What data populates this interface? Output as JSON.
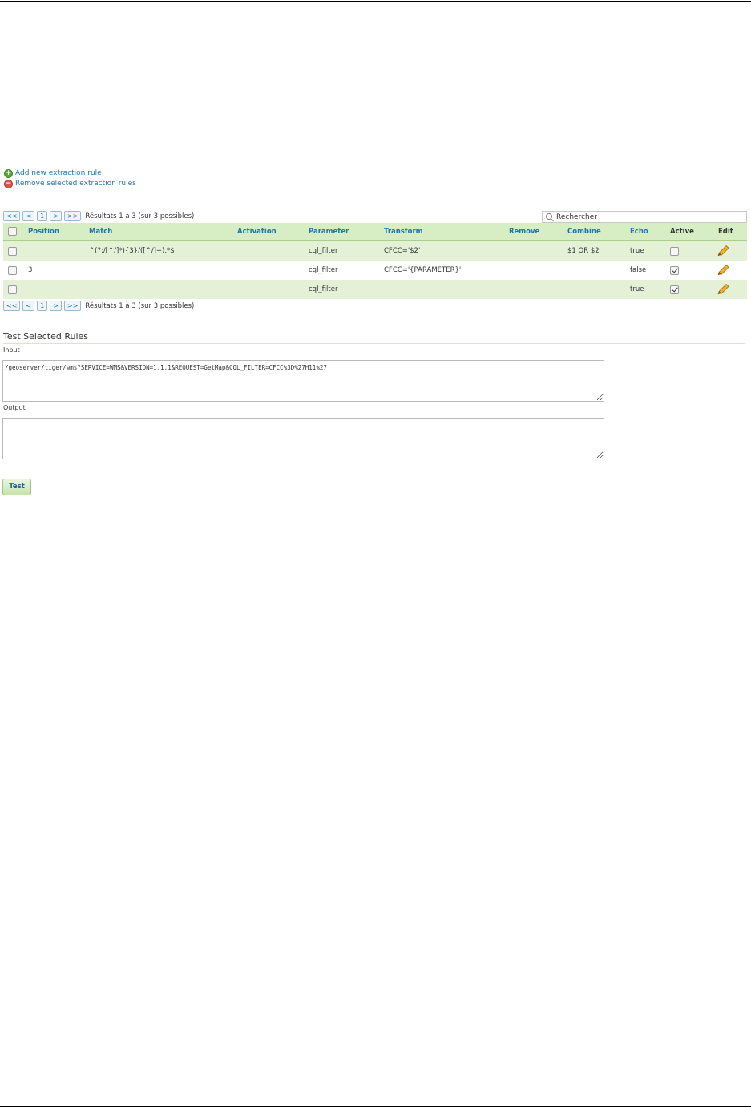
{
  "actions": {
    "add_label": "Add new extraction rule",
    "remove_label": "Remove selected extraction rules"
  },
  "pager": {
    "first": "<<",
    "prev": "<",
    "page": "1",
    "next": ">",
    "last": ">>",
    "results_text": "Résultats 1 à 3 (sur 3 possibles)"
  },
  "search": {
    "placeholder": "Rechercher"
  },
  "table": {
    "columns": {
      "position": "Position",
      "match": "Match",
      "activation": "Activation",
      "parameter": "Parameter",
      "transform": "Transform",
      "remove": "Remove",
      "combine": "Combine",
      "echo": "Echo",
      "active": "Active",
      "edit": "Edit"
    },
    "rows": [
      {
        "position": "",
        "match": "^(?:/[^/]*){3}/([^/]+).*$",
        "activation": "",
        "parameter": "cql_filter",
        "transform": "CFCC='$2'",
        "remove": "",
        "combine": "$1 OR $2",
        "echo": "true",
        "active": false
      },
      {
        "position": "3",
        "match": "",
        "activation": "",
        "parameter": "cql_filter",
        "transform": "CFCC='{PARAMETER}'",
        "remove": "",
        "combine": "",
        "echo": "false",
        "active": true
      },
      {
        "position": "",
        "match": "",
        "activation": "",
        "parameter": "cql_filter",
        "transform": "",
        "remove": "",
        "combine": "",
        "echo": "true",
        "active": true
      }
    ]
  },
  "test_section": {
    "title": "Test Selected Rules",
    "input_label": "Input",
    "input_value": "/geoserver/tiger/wms?SERVICE=WMS&VERSION=1.1.1&REQUEST=GetMap&CQL_FILTER=CFCC%3D%27H11%27",
    "output_label": "Output",
    "output_value": "",
    "test_button": "Test"
  },
  "colors": {
    "link": "#1f75a8",
    "header_bg": "#d7eec5",
    "odd_row_bg": "#e4f1d7"
  }
}
